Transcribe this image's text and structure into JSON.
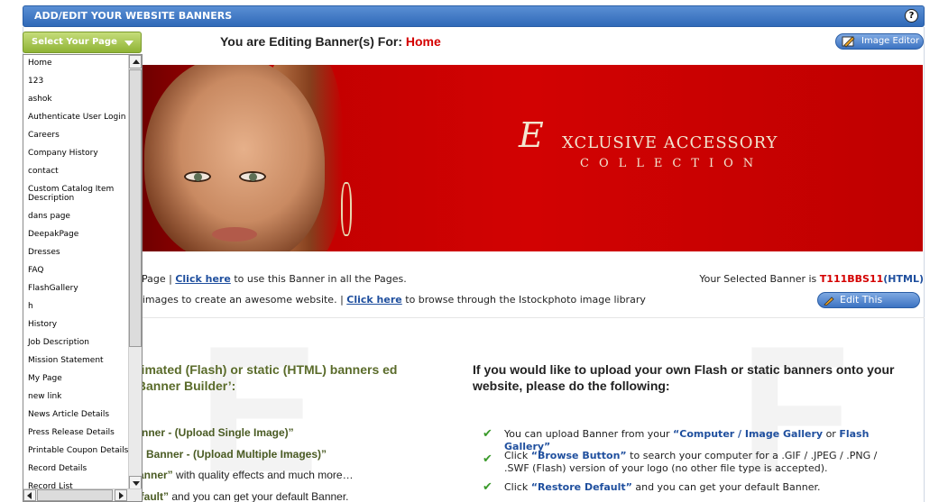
{
  "header": {
    "title": "ADD/EDIT YOUR WEBSITE BANNERS",
    "help_label": "?"
  },
  "editing": {
    "prefix": "You are Editing Banner(s) For:",
    "page": "Home"
  },
  "image_editor_label": "Image Editor",
  "banner": {
    "brand_initial": "E",
    "brand_line1": "XCLUSIVE ACCESSORY",
    "brand_line2": "COLLECTION"
  },
  "info": {
    "row1_start": "Page |",
    "row1_link": "Click here",
    "row1_end": "to use this Banner in all the Pages.",
    "row2_start": "k images to create an awesome website. |",
    "row2_link": "Click here",
    "row2_end": "to browse through the Istockphoto image library",
    "selected_prefix": "Your Selected Banner is",
    "selected_code": "T111BBS11",
    "selected_type": "(HTML)",
    "edit_banner_label": "Edit This Banner"
  },
  "left_section": {
    "heading": "nimated (Flash) or static (HTML) banners ed ‘Banner Builder’:",
    "item1": "nner - (Upload Single Image)”",
    "item2": "Banner - (Upload Multiple Images)”",
    "item3_bold": "anner”",
    "item3_rest": "with quality effects and much more…",
    "item4_bold": "efault”",
    "item4_rest": "and you can get your default Banner."
  },
  "right_section": {
    "heading": "If you would like to upload your own Flash or static banners onto your website, please do the following:",
    "item1_a": "You can upload Banner from your",
    "item1_b": "“Computer / Image Gallery",
    "item1_c": "or",
    "item1_d": "Flash Gallery”",
    "item2_a": "Click",
    "item2_b": "“Browse Button”",
    "item2_c": "to search your computer for a .GIF / .JPEG / .PNG / .SWF (Flash) version of your logo (no other file type is accepted).",
    "item3_a": "Click",
    "item3_b": "“Restore Default”",
    "item3_c": "and you can get your default Banner."
  },
  "dropdown": {
    "label": "Select Your Page",
    "items": [
      "Home",
      "123",
      "ashok",
      "Authenticate User Login",
      "Careers",
      "Company History",
      "contact",
      "Custom Catalog Item Description",
      "dans page",
      "DeepakPage",
      "Dresses",
      "FAQ",
      "FlashGallery",
      "h",
      "History",
      "Job Description",
      "Mission Statement",
      "My Page",
      "new link",
      "News Article Details",
      "Press Release Details",
      "Printable Coupon Details",
      "Record Details",
      "Record List"
    ]
  },
  "colors": {
    "header_blue": "#2f69b8",
    "dropdown_green": "#8fb335",
    "accent_red": "#d40000",
    "link_blue": "#1f4f9e"
  },
  "icons": [
    "help-icon",
    "pencil-icon",
    "chevron-down-icon",
    "check-icon",
    "scroll-arrow-icon"
  ]
}
